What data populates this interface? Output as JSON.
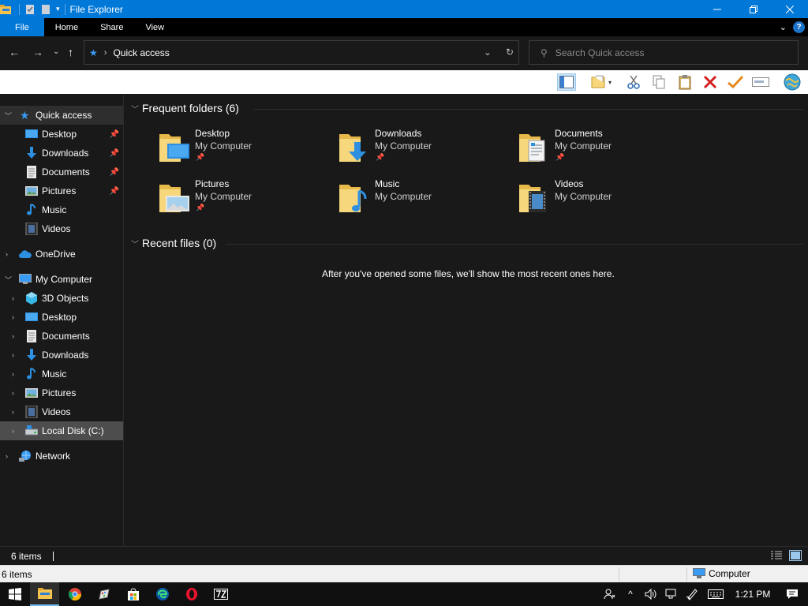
{
  "window": {
    "title": "File Explorer",
    "controls": [
      "minimize",
      "restore",
      "close"
    ]
  },
  "ribbon": {
    "tabs": [
      "File",
      "Home",
      "Share",
      "View"
    ],
    "accent": "#0078d7"
  },
  "address": {
    "path": "Quick access",
    "search_placeholder": "Search Quick access"
  },
  "toolbar": {
    "icons": [
      "navigation-pane-icon",
      "new-folder-icon",
      "cut-icon",
      "copy-icon",
      "paste-icon",
      "delete-icon",
      "checkmark-icon",
      "rename-icon",
      "globe-icon"
    ]
  },
  "nav": {
    "quick_access": "Quick access",
    "quick_items": [
      {
        "label": "Desktop",
        "pinned": true
      },
      {
        "label": "Downloads",
        "pinned": true
      },
      {
        "label": "Documents",
        "pinned": true
      },
      {
        "label": "Pictures",
        "pinned": true
      },
      {
        "label": "Music",
        "pinned": false
      },
      {
        "label": "Videos",
        "pinned": false
      }
    ],
    "onedrive": "OneDrive",
    "my_computer": "My Computer",
    "computer_items": [
      "3D Objects",
      "Desktop",
      "Documents",
      "Downloads",
      "Music",
      "Pictures",
      "Videos",
      "Local Disk (C:)"
    ],
    "network": "Network"
  },
  "content": {
    "frequent_title": "Frequent folders (6)",
    "folders": [
      {
        "name": "Desktop",
        "location": "My Computer",
        "pinned": true
      },
      {
        "name": "Downloads",
        "location": "My Computer",
        "pinned": true
      },
      {
        "name": "Documents",
        "location": "My Computer",
        "pinned": true
      },
      {
        "name": "Pictures",
        "location": "My Computer",
        "pinned": true
      },
      {
        "name": "Music",
        "location": "My Computer",
        "pinned": false
      },
      {
        "name": "Videos",
        "location": "My Computer",
        "pinned": false
      }
    ],
    "recent_title": "Recent files (0)",
    "empty_message": "After you've opened some files, we'll show the most recent ones here."
  },
  "status": {
    "items": "6 items",
    "items_lower": "6 items",
    "computer": "Computer"
  },
  "taskbar": {
    "apps": [
      "start-icon",
      "file-explorer-icon",
      "chrome-icon",
      "paint-icon",
      "store-icon",
      "edge-icon",
      "opera-icon",
      "7zip-icon"
    ],
    "clock": "1:21 PM"
  }
}
